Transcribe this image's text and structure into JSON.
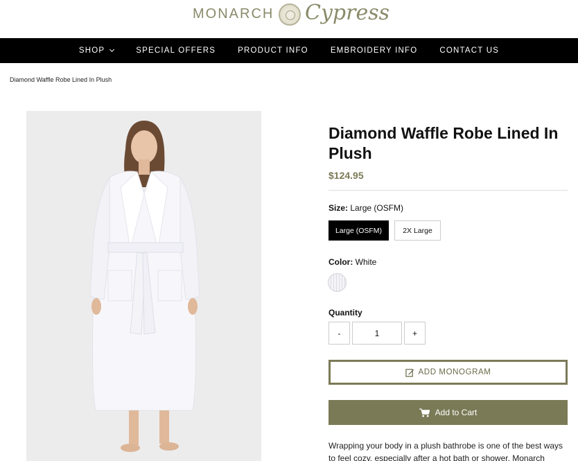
{
  "header": {
    "brand_left": "MONARCH",
    "brand_script": "Cypress"
  },
  "nav": {
    "items": [
      {
        "label": "SHOP"
      },
      {
        "label": "SPECIAL OFFERS"
      },
      {
        "label": "PRODUCT INFO"
      },
      {
        "label": "EMBROIDERY INFO"
      },
      {
        "label": "CONTACT US"
      }
    ]
  },
  "breadcrumb": "Diamond Waffle Robe Lined In Plush",
  "product": {
    "title": "Diamond Waffle Robe Lined In Plush",
    "price": "$124.95",
    "size_label": "Size:",
    "size_value": "Large (OSFM)",
    "sizes": [
      "Large (OSFM)",
      "2X Large"
    ],
    "selected_size": "Large (OSFM)",
    "color_label": "Color:",
    "color_value": "White",
    "quantity_label": "Quantity",
    "quantity_minus": "-",
    "quantity_plus": "+",
    "quantity_value": "1",
    "monogram_label": "ADD MONOGRAM",
    "cart_label": "Add to Cart",
    "description": "Wrapping your body in a plush bathrobe is one of the best ways to feel cozy, especially after a hot bath or shower. Monarch"
  },
  "colors": {
    "accent": "#7b7a57",
    "nav_bg": "#000000"
  }
}
